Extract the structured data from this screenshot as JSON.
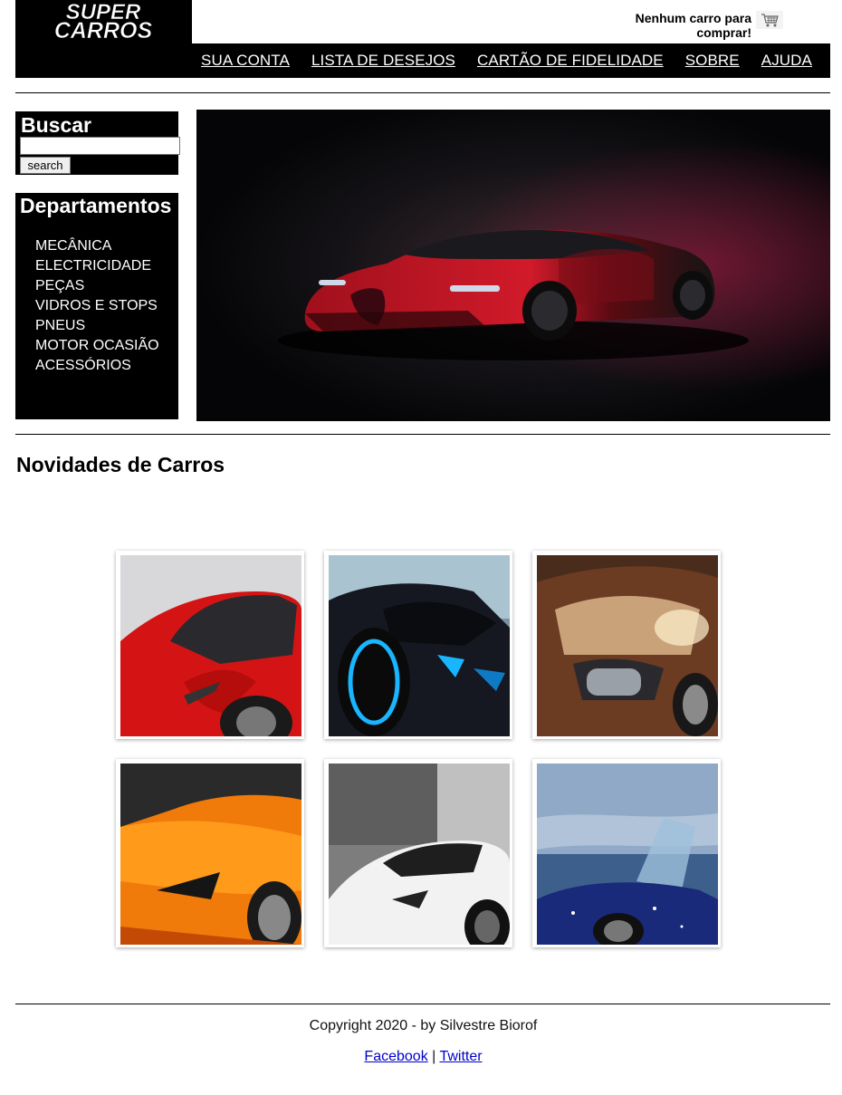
{
  "header": {
    "logo_alt": "SUPER CARROS",
    "cart_text": "Nenhum carro para\ncomprar!"
  },
  "nav": {
    "items": [
      "SUA CONTA",
      "LISTA DE DESEJOS",
      "CARTÃO DE FIDELIDADE",
      "SOBRE",
      "AJUDA"
    ]
  },
  "search": {
    "title": "Buscar",
    "value": "",
    "button_label": "search"
  },
  "departments": {
    "title": "Departamentos",
    "items": [
      "MECÂNICA",
      "ELECTRICIDADE",
      "PEÇAS",
      "VIDROS E STOPS",
      "PNEUS",
      "MOTOR OCASIÃO",
      "ACESSÓRIOS"
    ]
  },
  "main": {
    "section_title": "Novidades de Carros"
  },
  "footer": {
    "copyright": "Copyright 2020 - by Silvestre Biorof",
    "links": [
      "Facebook",
      "Twitter"
    ],
    "separator": "|"
  },
  "colors": {
    "header_bg": "#000000",
    "link_blue": "#0000cc"
  }
}
